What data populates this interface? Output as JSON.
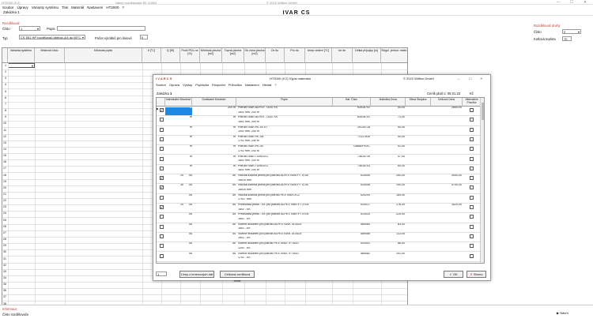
{
  "window": {
    "title_left": "HT2000 (9.2)",
    "title_mid": "Návrh rozdělovače EK 11346",
    "title_right": "© 2022 Wilfinn GmbH",
    "controls": [
      "—",
      "☐",
      "✕"
    ]
  },
  "menu": [
    "Soubor",
    "Úpravy",
    "Varianty systému",
    "Tisk",
    "Materiál",
    "Nastavení",
    "HT2000",
    "?"
  ],
  "subtitle": "Zakázka 1",
  "app_heading": "IVAR CS",
  "form": {
    "section_label": "Rozdělovač",
    "cislo_label": "Číslo",
    "cislo_value": "1",
    "popis_label": "Popis",
    "popis_value": "",
    "typ_label": "Typ",
    "typ_value": "CS 551 HP rozdělovač-sběrač-4/4 do 55°C",
    "pocet_label": "Počet výrobků pro liniové",
    "pocet_value": "0"
  },
  "right_box": {
    "title": "Rozdělovač druhý",
    "cislo_label": "Číslo",
    "cislo_value": "0",
    "teplota_label": "Kotlová teplota",
    "teplota_value": "70"
  },
  "grid": {
    "headers": [
      "Varianta systému",
      "Místnost číslo",
      "Místnost popis",
      "ti [°C]",
      "Q [W]",
      "Podíl PDL na [%]",
      "Místnost plocha [m2]",
      "Topná plocha [m2]",
      "Ok zóna plocha [m2]",
      "Ox do",
      "Pro do",
      "temp vedení [°C]",
      "Uo do",
      "Délka přípojky [m]",
      "Regul. jednot. místn"
    ],
    "rows": [
      "1",
      "2",
      "3",
      "4",
      "5",
      "6",
      "7",
      "8",
      "9",
      "10",
      "11",
      "12",
      "13",
      "14",
      "15",
      "16",
      "17",
      "18",
      "19",
      "20",
      "21",
      "22",
      "23",
      "24",
      "25",
      "26",
      "27",
      "28",
      "29",
      "30",
      "31",
      "32",
      "33",
      "34",
      "35",
      "36",
      "37",
      "38"
    ]
  },
  "status": {
    "info_label": "Informace",
    "info_text": "Číslo rozdělovače",
    "next_button": "Návrh"
  },
  "dialog": {
    "logo": "I V A R  C S",
    "title": "HT2000 (9.2)   Výpis materiálu",
    "copyright": "© 2022 Wilfinn GmbH",
    "menu": [
      "Soubor",
      "Oprava",
      "Výstup",
      "Poptávka",
      "Rozpočet",
      "Průvodka",
      "Nastavení",
      "Hledat",
      "?"
    ],
    "zakazka_label": "Zakázka",
    "zakazka_value": "1",
    "cenik_label": "Ceník platí o: 05.01.23",
    "cenik_value": "Kč",
    "headers": [
      "Individuální Množství",
      "Dodávané Množství",
      "Popis",
      "Kat. Číslo",
      "Jednotka Cena",
      "Sleva Skupina",
      "Celková Cena",
      "Alternativa Položka"
    ],
    "rows": [
      {
        "mj": "m",
        "qty": "",
        "dod": "200 m",
        "p1": "Potrubí IVAR.ALPEX - DUO XS",
        "p2": "16x2 mm, 200 m",
        "kat": "63516701",
        "cena": "50,00",
        "celk": "2600,00",
        "sel": true,
        "chk": true
      },
      {
        "mj": "m",
        "qty": "",
        "dod": "m",
        "p1": "Potrubí IVAR.ALPEX - DUO XS",
        "p2": "16x2 mm, 200 m",
        "kat": "63516701",
        "cena": "73,00",
        "celk": "",
        "sel": false,
        "chk": false
      },
      {
        "mj": "m",
        "qty": "",
        "dod": "m",
        "p1": "Potrubí IVAR.PE-Xc ST",
        "p2": "10x2 mm, 200 m",
        "kat": "29130718",
        "cena": "50,00",
        "celk": "",
        "sel": false,
        "chk": false
      },
      {
        "mj": "m",
        "qty": "",
        "dod": "m",
        "p1": "Potrubí IVAR.PE-Xa",
        "p2": "17x2 mm, 240 m",
        "kat": "71317835",
        "cena": "40,00",
        "celk": "",
        "sel": false,
        "chk": false
      },
      {
        "mj": "m",
        "qty": "",
        "dod": "m",
        "p1": "Potrubí IVAR.PE-Xc",
        "p2": "17x2 mm, 240 m",
        "kat": "728660PEXC",
        "cena": "51,00",
        "celk": "",
        "sel": false,
        "chk": false
      },
      {
        "mj": "m",
        "qty": "",
        "dod": "m",
        "p1": "Potrubí IVAR.TURATEC",
        "p2": "16x2 mm, 200 m",
        "kat": "73616739",
        "cena": "47,00",
        "celk": "",
        "sel": false,
        "chk": false
      },
      {
        "mj": "m",
        "qty": "",
        "dod": "m",
        "p1": "Potrubí IVAR.TURATEC",
        "p2": "16x2 mm, 200 m",
        "kat": "73616703",
        "cena": "69,00",
        "celk": "",
        "sel": false,
        "chk": false
      },
      {
        "mj": "ks",
        "qty": "20",
        "dod": "ks",
        "p1": "Vsuvka kovová přímá pro potrubí ALPEX IVAR.PT 5705",
        "p2": "16x16 mm",
        "kat": "510005",
        "cena": "150,00",
        "celk": "3000,00",
        "sel": false,
        "chk": true
      },
      {
        "mj": "ks",
        "qty": "30",
        "dod": "ks",
        "p1": "Vsuvka kovová přímá pro potrubí ALPEX IVAR.PT 5705",
        "p2": "16x16 mm",
        "kat": "510008",
        "cena": "190,00",
        "celk": "5700,00",
        "sel": false,
        "chk": true
      },
      {
        "mj": "ks",
        "qty": "",
        "dod": "ks",
        "p1": "Vsuvka kovová přímá pro potrubí PEX IVAR.XC2",
        "p2": "17x17 mm",
        "kat": "520293",
        "cena": "184,00",
        "celk": "",
        "sel": false,
        "chk": false
      },
      {
        "mj": "ks",
        "qty": "20",
        "dod": "ks",
        "p1": "Přechodka press - EK pro potrubí ALPEX IVAR.PT 5705",
        "p2": "16x2 - EK",
        "kat": "510017",
        "cena": "176,00",
        "celk": "3520,00",
        "sel": false,
        "chk": true
      },
      {
        "mj": "ks",
        "qty": "",
        "dod": "ks",
        "p1": "Přechodka press - EK pro potrubí ALPEX IVAR.PT 5705",
        "p2": "16x2 - EK",
        "kat": "513020",
        "cena": "225,00",
        "celk": "",
        "sel": false,
        "chk": false
      },
      {
        "mj": "ks",
        "qty": "",
        "dod": "ks",
        "p1": "Svěrné šroubení pro potrubí ALPEX IVAR.TA 4420",
        "p2": "16x2 - EK",
        "kat": "569084",
        "cena": "83,00",
        "celk": "",
        "sel": false,
        "chk": false
      },
      {
        "mj": "ks",
        "qty": "",
        "dod": "ks",
        "p1": "Svěrné šroubení pro potrubí ALPEX IVAR.TA 4425",
        "p2": "16x2 - EK",
        "kat": "569085",
        "cena": "113,00",
        "celk": "",
        "sel": false,
        "chk": false
      },
      {
        "mj": "ks",
        "qty": "",
        "dod": "ks",
        "p1": "Svěrné šroubení pro potrubí PEX IVAR.TP 4410",
        "p2": "12x2 - EK",
        "kat": "520041",
        "cena": "88,00",
        "celk": "",
        "sel": false,
        "chk": false
      },
      {
        "mj": "ks",
        "qty": "",
        "dod": "ks",
        "p1": "Svěrné šroubení pro potrubí PEX IVAR.TP 4410",
        "p2": "17x2 - EK",
        "kat": "569082",
        "cena": "191,00",
        "celk": "",
        "sel": false,
        "chk": false
      }
    ],
    "pager_value": "1",
    "btn_ceny": "Ceny z kmenových dat",
    "btn_celkova": "Celková cenitková cena",
    "btn_ok": "OK",
    "btn_storno": "Storno"
  }
}
